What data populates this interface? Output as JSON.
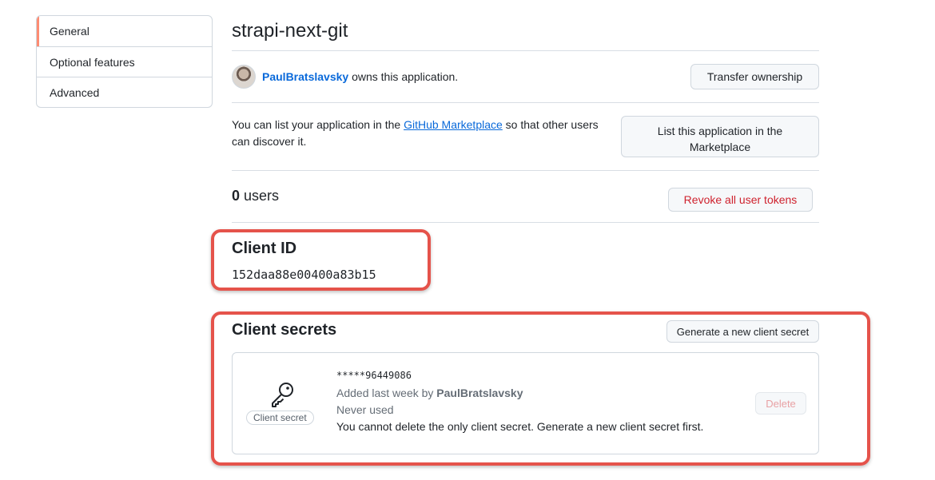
{
  "sidebar": {
    "items": [
      {
        "label": "General"
      },
      {
        "label": "Optional features"
      },
      {
        "label": "Advanced"
      }
    ]
  },
  "app": {
    "title": "strapi-next-git"
  },
  "owner": {
    "username": "PaulBratslavsky",
    "suffix": " owns this application.",
    "transfer_button": "Transfer ownership"
  },
  "marketplace": {
    "text_before": "You can list your application in the ",
    "link_text": "GitHub Marketplace",
    "text_after": " so that other users can discover it.",
    "button_line1": "List this application in the",
    "button_line2": "Marketplace"
  },
  "users": {
    "count": "0",
    "label": " users",
    "revoke_button": "Revoke all user tokens"
  },
  "client_id": {
    "heading": "Client ID",
    "value": "152daa88e00400a83b15"
  },
  "client_secrets": {
    "heading": "Client secrets",
    "generate_button": "Generate a new client secret",
    "secret": {
      "icon": "key-icon",
      "badge": "Client secret",
      "masked_value": "*****96449086",
      "added_prefix": "Added last week by ",
      "added_by": "PaulBratslavsky",
      "usage": "Never used",
      "warning": "You cannot delete the only client secret. Generate a new client secret first.",
      "delete_button": "Delete"
    }
  },
  "colors": {
    "accent_link": "#0969da",
    "danger": "#cf222e",
    "highlight": "#e5534b",
    "sidebar_active": "#fd8c73"
  }
}
